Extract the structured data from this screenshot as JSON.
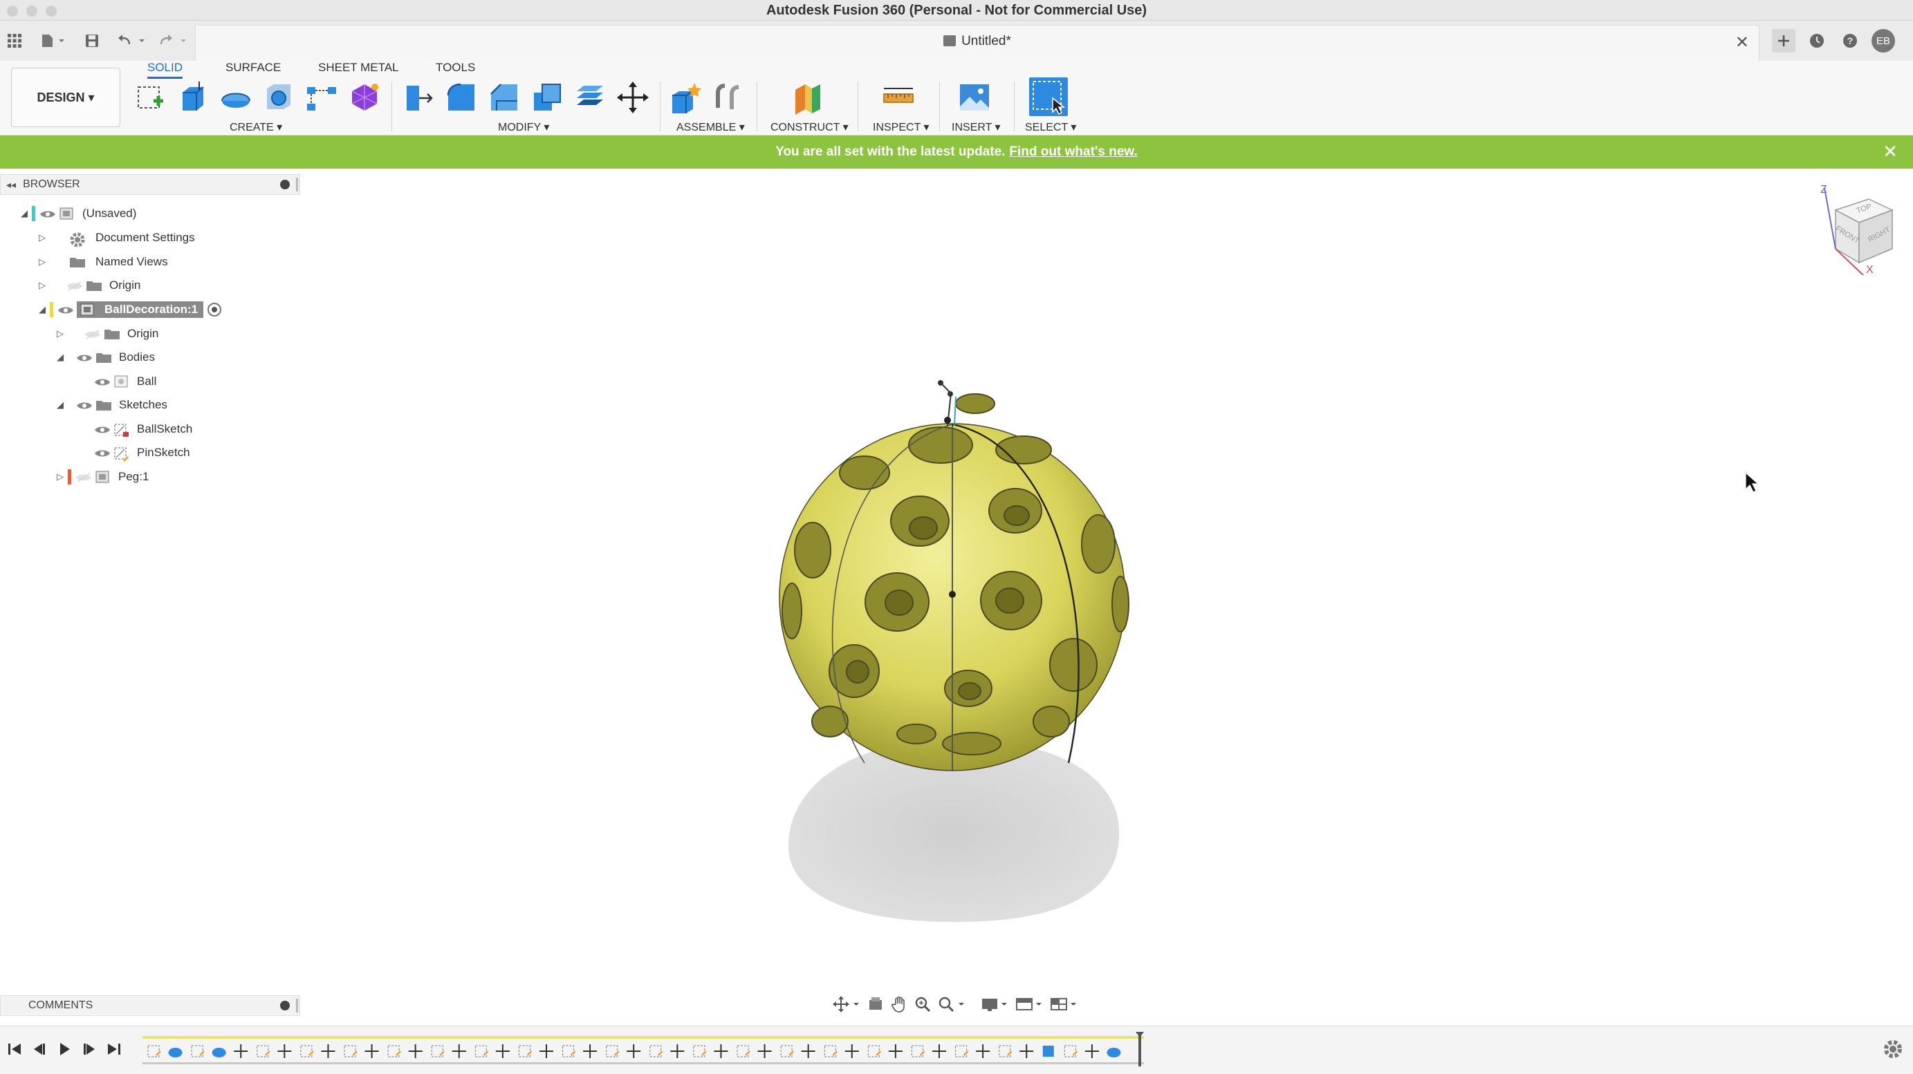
{
  "window": {
    "title": "Autodesk Fusion 360 (Personal - Not for Commercial Use)"
  },
  "document": {
    "title": "Untitled*",
    "user_initials": "EB"
  },
  "ribbon": {
    "workspace": "DESIGN ▾",
    "tabs": [
      "SOLID",
      "SURFACE",
      "SHEET METAL",
      "TOOLS"
    ],
    "active_tab": "SOLID",
    "groups": {
      "create": "CREATE ▾",
      "modify": "MODIFY ▾",
      "assemble": "ASSEMBLE ▾",
      "construct": "CONSTRUCT ▾",
      "inspect": "INSPECT ▾",
      "insert": "INSERT ▾",
      "select": "SELECT ▾"
    }
  },
  "banner": {
    "text": "You are all set with the latest update.",
    "link": "Find out what's new."
  },
  "browser": {
    "title": "BROWSER",
    "items": [
      {
        "label": "(Unsaved)"
      },
      {
        "label": "Document Settings"
      },
      {
        "label": "Named Views"
      },
      {
        "label": "Origin"
      },
      {
        "label": "BallDecoration:1"
      },
      {
        "label": "Origin"
      },
      {
        "label": "Bodies"
      },
      {
        "label": "Ball"
      },
      {
        "label": "Sketches"
      },
      {
        "label": "BallSketch"
      },
      {
        "label": "PinSketch"
      },
      {
        "label": "Peg:1"
      }
    ]
  },
  "viewcube": {
    "top": "TOP",
    "front": "FRONT",
    "right": "RIGHT",
    "axis_z": "Z",
    "axis_x": "X"
  },
  "comments": {
    "title": "COMMENTS"
  },
  "colors": {
    "accent": "#1a6fcf",
    "banner": "#8cc43f",
    "ball": "#d9d45a"
  }
}
